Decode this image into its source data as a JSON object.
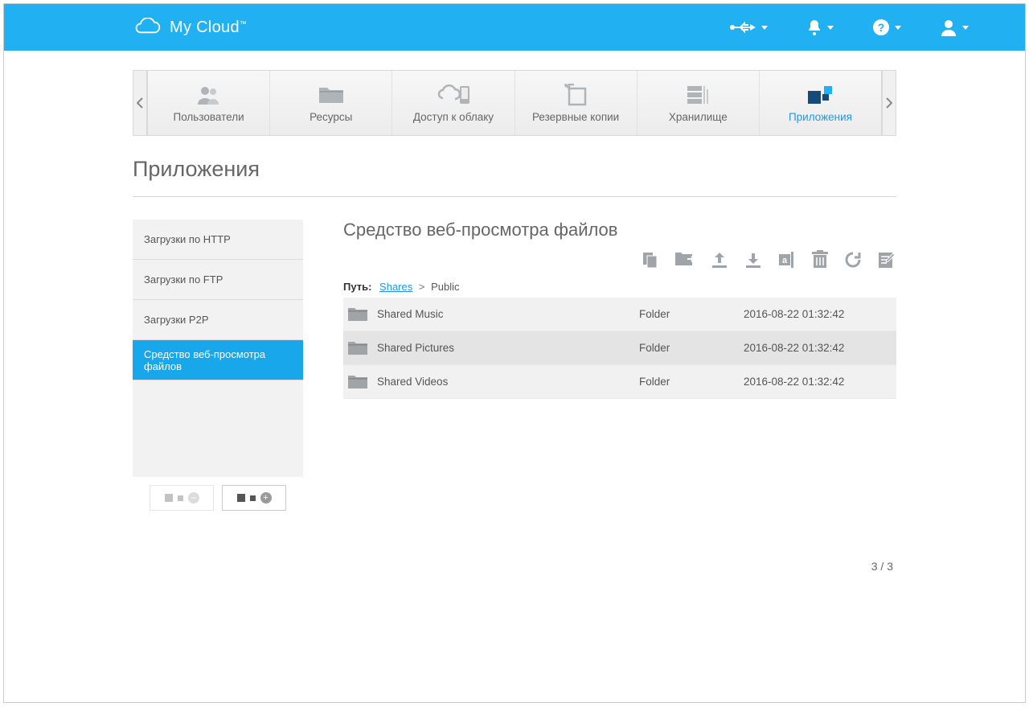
{
  "brand": "My Cloud",
  "nav": {
    "items": [
      {
        "label": "Пользователи"
      },
      {
        "label": "Ресурсы"
      },
      {
        "label": "Доступ к облаку"
      },
      {
        "label": "Резервные копии"
      },
      {
        "label": "Хранилище"
      },
      {
        "label": "Приложения"
      }
    ]
  },
  "page": {
    "title": "Приложения"
  },
  "sidebar": {
    "items": [
      {
        "label": "Загрузки по HTTP"
      },
      {
        "label": "Загрузки по FTP"
      },
      {
        "label": "Загрузки P2P"
      },
      {
        "label": "Средство веб-просмотра файлов"
      }
    ]
  },
  "viewer": {
    "heading": "Средство веб-просмотра файлов",
    "path_label": "Путь:",
    "path_root": "Shares",
    "path_current": "Public",
    "rows": [
      {
        "name": "Shared Music",
        "type": "Folder",
        "date": "2016-08-22 01:32:42"
      },
      {
        "name": "Shared Pictures",
        "type": "Folder",
        "date": "2016-08-22 01:32:42"
      },
      {
        "name": "Shared Videos",
        "type": "Folder",
        "date": "2016-08-22 01:32:42"
      }
    ],
    "pager": "3 / 3"
  }
}
